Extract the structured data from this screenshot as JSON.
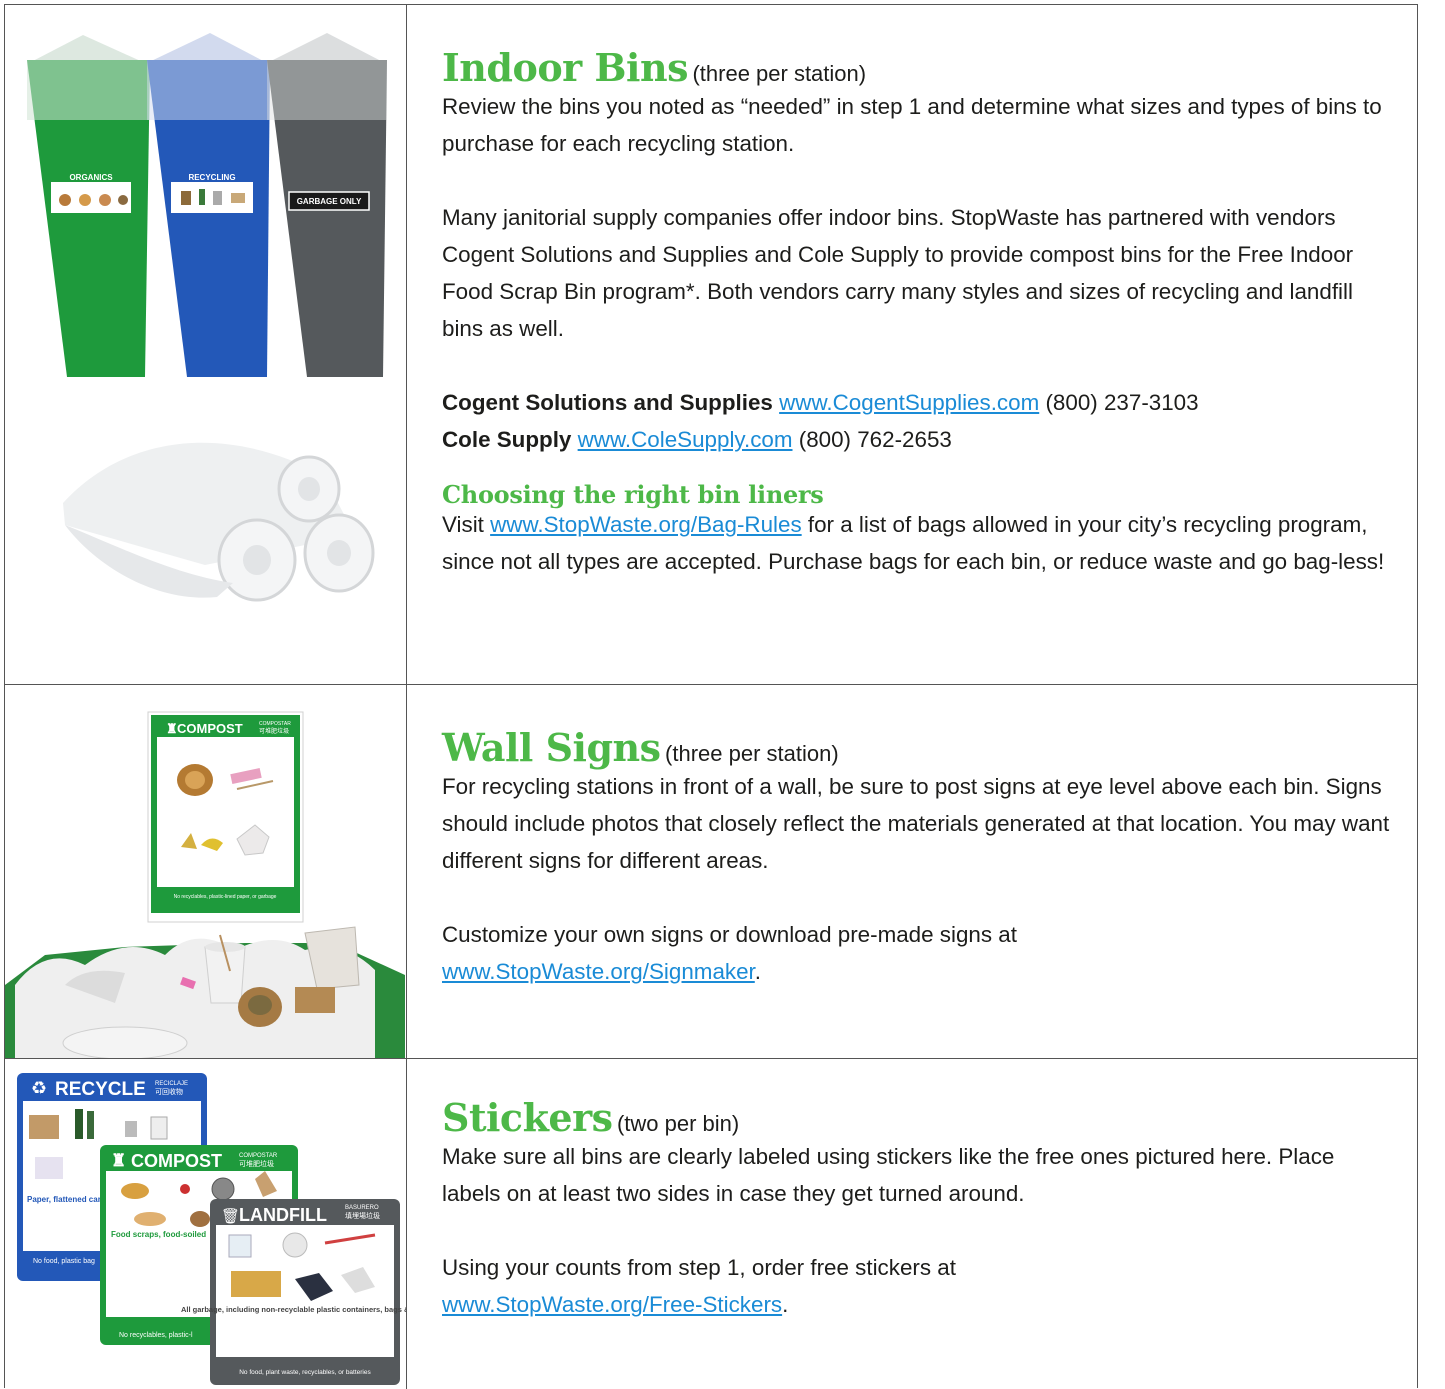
{
  "indoor_bins": {
    "title": "Indoor Bins",
    "qualifier": "(three per station)",
    "para1": "Review the bins you noted as “needed” in step 1 and determine what sizes and types of bins to purchase for each recycling station.",
    "para2": "Many janitorial supply companies offer indoor bins. StopWaste has partnered with vendors Cogent Solutions and Supplies and Cole Supply to provide compost bins for the Free Indoor Food Scrap Bin program*. Both vendors carry many styles and sizes of recycling and landfill bins as well.",
    "vendors": [
      {
        "name": "Cogent Solutions and Supplies",
        "url": "www.CogentSupplies.com",
        "phone": "(800) 237-3103"
      },
      {
        "name": "Cole Supply",
        "url": "www.ColeSupply.com",
        "phone": "(800) 762-2653"
      }
    ],
    "liners_title": "Choosing the right bin liners",
    "liners_pre": "Visit ",
    "liners_link": "www.StopWaste.org/Bag-Rules",
    "liners_post": " for a list of bags allowed in your city’s recycling program, since not all types are accepted. Purchase bags for each bin, or reduce waste and go bag-less!",
    "bin_labels": [
      "ORGANICS",
      "RECYCLING",
      "GARBAGE ONLY"
    ]
  },
  "wall_signs": {
    "title": "Wall Signs",
    "qualifier": "(three per station)",
    "para1": "For recycling stations in front of a wall, be sure to post signs at eye level above each bin. Signs should include photos that closely reflect the materials generated at that location. You may want different signs for different areas.",
    "para2_pre": "Customize your own signs or download pre-made signs at",
    "para2_link": "www.StopWaste.org/Signmaker",
    "para2_post": ".",
    "sign_title": "COMPOST",
    "sign_sub1": "COMPOSTAR",
    "sign_sub2": "可堆肥垃圾",
    "sign_footer": "No recyclables, plastic-lined paper, or garbage"
  },
  "stickers": {
    "title": "Stickers",
    "qualifier": "(two per bin)",
    "para1": "Make sure all bins are clearly labeled using stickers like the free ones pictured here. Place labels on at least two sides in case they get turned around.",
    "para2_pre": "Using your counts from step 1, order free stickers at",
    "para2_link": "www.StopWaste.org/Free-Stickers",
    "para2_post": ".",
    "recycle_title": "RECYCLE",
    "recycle_sub1": "RECICLAJE",
    "recycle_sub2": "可回收物",
    "recycle_caption": "Paper, flattened card",
    "recycle_footer": "No food, plastic bag",
    "compost_title": "COMPOST",
    "compost_sub1": "COMPOSTAR",
    "compost_sub2": "可堆肥垃圾",
    "compost_caption": "Food scraps, food-soiled",
    "compost_footer": "No recyclables, plastic-l",
    "landfill_title": "LANDFILL",
    "landfill_sub1": "BASURERO",
    "landfill_sub2": "填埋場垃圾",
    "landfill_caption": "All garbage, including non-recyclable plastic containers, bags & wrap",
    "landfill_footer": "No food, plant waste, recyclables, or batteries"
  },
  "colors": {
    "heading_green": "#4db848",
    "link_blue": "#1a8bd6",
    "bin_green": "#1e9a3c",
    "bin_blue": "#2358b8",
    "bin_gray": "#55595c"
  }
}
